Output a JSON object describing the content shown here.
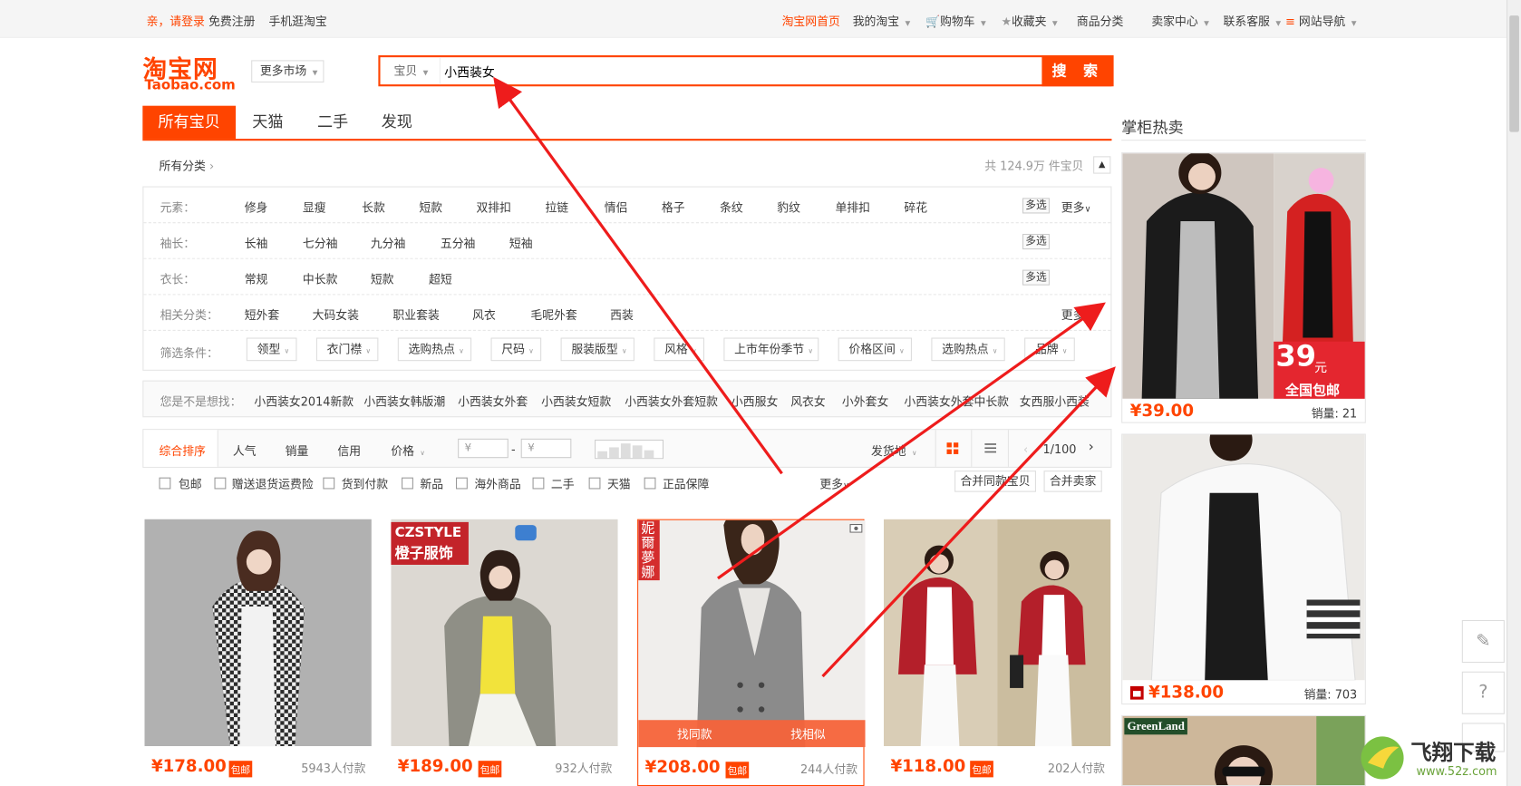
{
  "topbar": {
    "login": "亲，请登录",
    "register": "免费注册",
    "mobile": "手机逛淘宝",
    "home": "淘宝网首页",
    "my_taobao": "我的淘宝",
    "cart": "购物车",
    "fav": "收藏夹",
    "category": "商品分类",
    "seller": "卖家中心",
    "service": "联系客服",
    "sitenav": "网站导航"
  },
  "logo": {
    "cn": "淘宝网",
    "en": "Taobao.com"
  },
  "more_market": "更多市场",
  "search": {
    "type": "宝贝",
    "query": "小西装女",
    "button": "搜 索"
  },
  "tabs": [
    "所有宝贝",
    "天猫",
    "二手",
    "发现"
  ],
  "sidebar": {
    "title": "掌柜热卖",
    "items": [
      {
        "price": "¥39.00",
        "sold": "销量: 21",
        "promo_big": "39",
        "promo_unit": "元",
        "promo_text": "全国包邮"
      },
      {
        "price": "¥138.00",
        "sold": "销量: 703"
      },
      {
        "brand": "GreenLand"
      }
    ]
  },
  "crumb": "所有分类",
  "total": "共 124.9万 件宝贝",
  "attrs": [
    {
      "key": "元素：",
      "values": [
        "修身",
        "显瘦",
        "长款",
        "短款",
        "双排扣",
        "拉链",
        "情侣",
        "格子",
        "条纹",
        "豹纹",
        "单排扣",
        "碎花"
      ],
      "multi": "多选",
      "more": "更多"
    },
    {
      "key": "袖长：",
      "values": [
        "长袖",
        "七分袖",
        "九分袖",
        "五分袖",
        "短袖"
      ],
      "multi": "多选"
    },
    {
      "key": "衣长：",
      "values": [
        "常规",
        "中长款",
        "短款",
        "超短"
      ],
      "multi": "多选"
    },
    {
      "key": "相关分类：",
      "values": [
        "短外套",
        "大码女装",
        "职业套装",
        "风衣",
        "毛呢外套",
        "西装"
      ],
      "more": "更多"
    }
  ],
  "filters": {
    "key": "筛选条件：",
    "values": [
      "领型",
      "衣门襟",
      "选购热点",
      "尺码",
      "服装版型",
      "风格",
      "上市年份季节",
      "价格区间",
      "选购热点",
      "品牌"
    ]
  },
  "guess": {
    "key": "您是不是想找：",
    "values": [
      "小西装女2014新款",
      "小西装女韩版潮",
      "小西装女外套",
      "小西装女短款",
      "小西装女外套短款",
      "小西服女",
      "风衣女",
      "小外套女",
      "小西装女外套中长款",
      "女西服小西装"
    ]
  },
  "sort": {
    "items": [
      "综合排序",
      "人气",
      "销量",
      "信用",
      "价格"
    ],
    "price_from": "¥",
    "price_sep": "-",
    "price_to": "¥",
    "ship": "发货地",
    "page": "1/100"
  },
  "checks": {
    "items": [
      "包邮",
      "赠送退货运费险",
      "货到付款",
      "新品",
      "海外商品",
      "二手",
      "天猫",
      "正品保障"
    ],
    "more": "更多",
    "merge1": "合并同款宝贝",
    "merge2": "合并卖家"
  },
  "products": [
    {
      "price": "¥178.00",
      "bao": "包邮",
      "paid": "5943人付款"
    },
    {
      "price": "¥189.00",
      "bao": "包邮",
      "paid": "932人付款",
      "brand": "CZSTYLE",
      "brand_sub": "橙子服饰"
    },
    {
      "price": "¥208.00",
      "bao": "包邮",
      "paid": "244人付款",
      "brand_v": "妮爾夢娜",
      "same": "找同款",
      "similar": "找相似"
    },
    {
      "price": "¥118.00",
      "bao": "包邮",
      "paid": "202人付款"
    }
  ],
  "watermark": {
    "name": "飞翔下载",
    "url": "www.52z.com"
  }
}
